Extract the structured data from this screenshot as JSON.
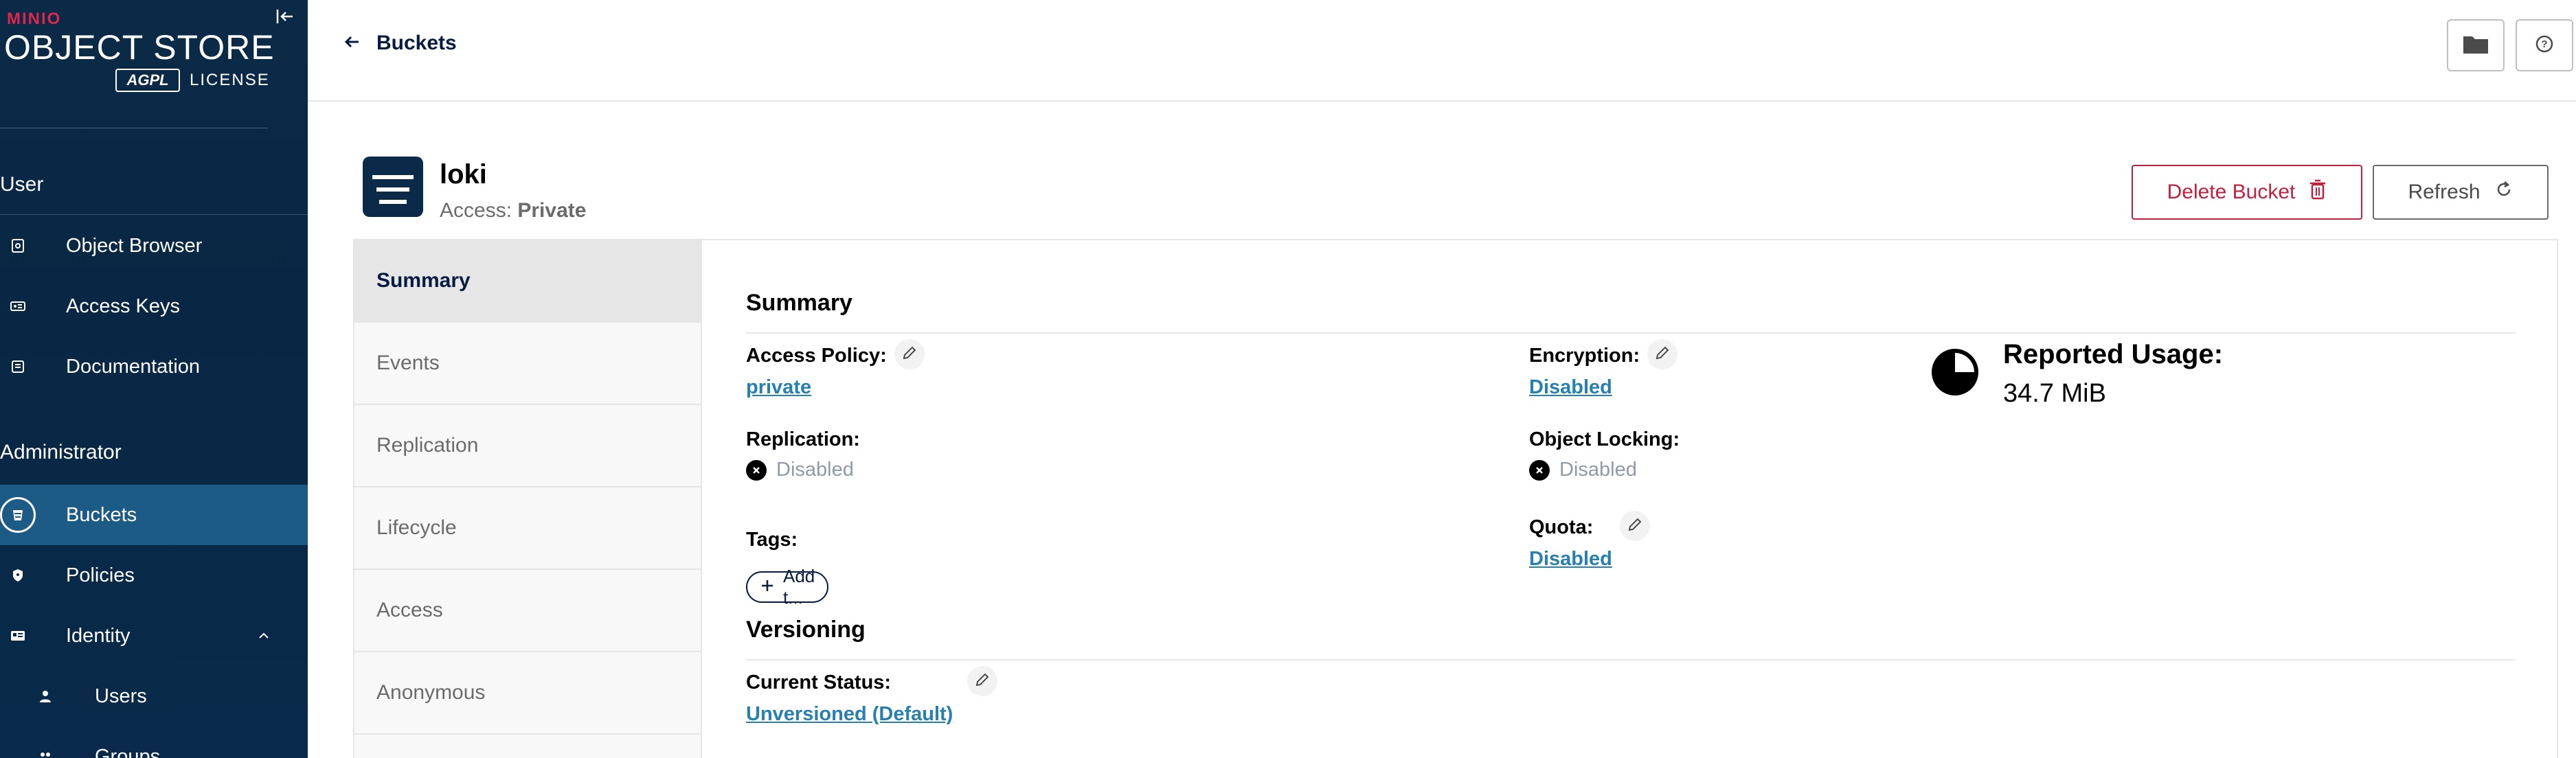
{
  "sidebar": {
    "brand_minio": "MINIO",
    "brand_title": "OBJECT STORE",
    "agpl": "AGPL",
    "license": "LICENSE",
    "user_section": "User",
    "user_items": [
      {
        "label": "Object Browser",
        "icon": "object-browser-icon"
      },
      {
        "label": "Access Keys",
        "icon": "access-keys-icon"
      },
      {
        "label": "Documentation",
        "icon": "documentation-icon"
      }
    ],
    "admin_section": "Administrator",
    "admin_items": [
      {
        "label": "Buckets",
        "icon": "bucket-icon",
        "active": true
      },
      {
        "label": "Policies",
        "icon": "policy-shield-icon"
      },
      {
        "label": "Identity",
        "icon": "identity-card-icon",
        "expanded": true
      }
    ],
    "identity_sub_items": [
      {
        "label": "Users",
        "icon": "user-icon"
      },
      {
        "label": "Groups",
        "icon": "groups-icon"
      }
    ]
  },
  "topbar": {
    "back_label": "Buckets"
  },
  "bucket": {
    "name": "loki",
    "access_prefix": "Access:",
    "access_value": "Private",
    "delete_label": "Delete Bucket",
    "refresh_label": "Refresh"
  },
  "tabs": [
    {
      "label": "Summary",
      "active": true
    },
    {
      "label": "Events"
    },
    {
      "label": "Replication"
    },
    {
      "label": "Lifecycle"
    },
    {
      "label": "Access"
    },
    {
      "label": "Anonymous"
    }
  ],
  "summary": {
    "title": "Summary",
    "access_policy_label": "Access Policy:",
    "access_policy_value": "private",
    "encryption_label": "Encryption:",
    "encryption_value": "Disabled",
    "replication_label": "Replication:",
    "replication_value": "Disabled",
    "object_locking_label": "Object Locking:",
    "object_locking_value": "Disabled",
    "tags_label": "Tags:",
    "add_tag_label": "Add t...",
    "quota_label": "Quota:",
    "quota_value": "Disabled",
    "usage_label": "Reported Usage:",
    "usage_value": "34.7 MiB"
  },
  "versioning": {
    "title": "Versioning",
    "status_label": "Current Status:",
    "status_value": "Unversioned (Default)"
  },
  "colors": {
    "sidebar_bg": "#0a2a47",
    "active_item": "#1b5b85",
    "link": "#2781b0",
    "danger": "#c51f3f",
    "brand_red": "#e0264c"
  }
}
